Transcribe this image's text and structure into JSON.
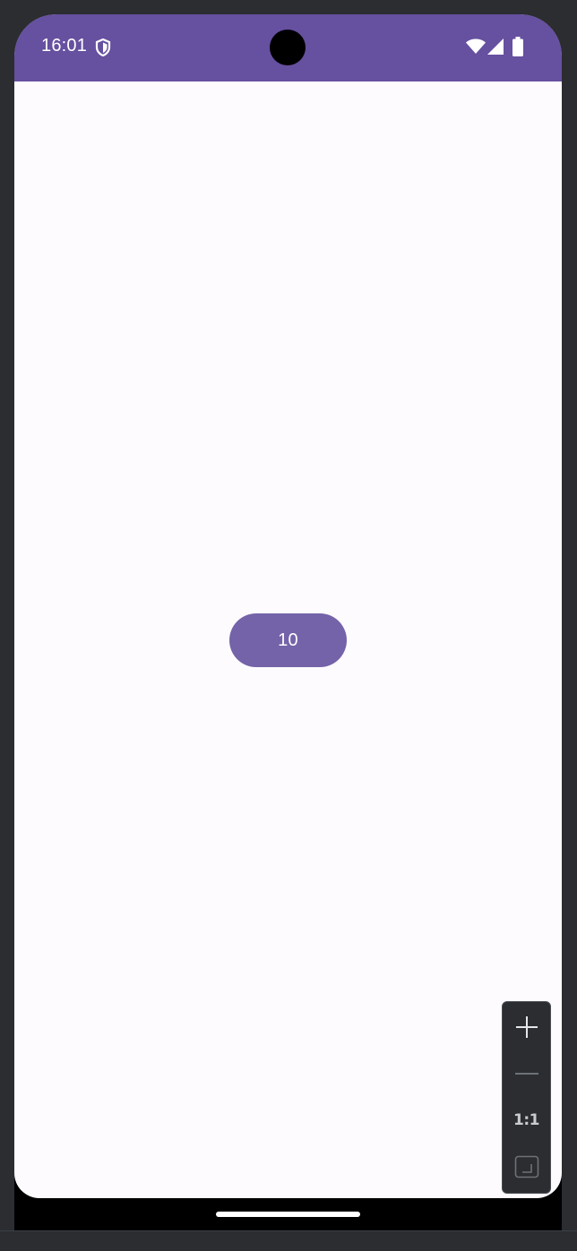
{
  "status_bar": {
    "time": "16:01",
    "icons": [
      "shield-icon",
      "wifi-icon",
      "signal-icon",
      "battery-icon"
    ]
  },
  "main": {
    "counter_button_label": "10"
  },
  "zoom_controls": {
    "items": [
      {
        "icon": "plus-icon",
        "label": ""
      },
      {
        "icon": "minus-icon",
        "label": ""
      },
      {
        "icon": "actual-size-icon",
        "label": "1:1"
      },
      {
        "icon": "fit-screen-icon",
        "label": ""
      }
    ]
  },
  "colors": {
    "accent": "#6650a0",
    "button": "#7463a9",
    "background": "#fdfbfe",
    "frame": "#2b2d31"
  }
}
